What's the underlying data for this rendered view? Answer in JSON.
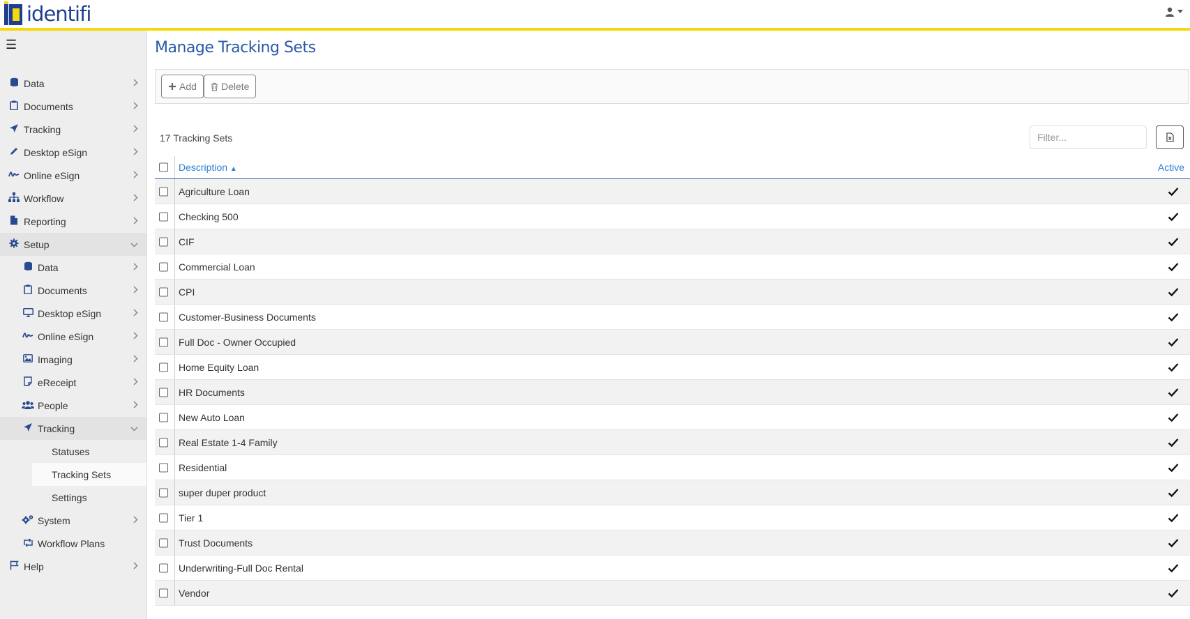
{
  "header": {
    "logo_text": "identifi",
    "user_icon": "user-icon"
  },
  "sidebar": {
    "items": [
      {
        "label": "Data",
        "icon": "database-icon"
      },
      {
        "label": "Documents",
        "icon": "clipboard-icon"
      },
      {
        "label": "Tracking",
        "icon": "paper-plane-icon"
      },
      {
        "label": "Desktop eSign",
        "icon": "pencil-icon"
      },
      {
        "label": "Online eSign",
        "icon": "signature-icon"
      },
      {
        "label": "Workflow",
        "icon": "sitemap-icon"
      },
      {
        "label": "Reporting",
        "icon": "file-icon"
      },
      {
        "label": "Setup",
        "icon": "gear-icon"
      }
    ],
    "setup_items": [
      {
        "label": "Data",
        "icon": "database-icon"
      },
      {
        "label": "Documents",
        "icon": "clipboard-icon"
      },
      {
        "label": "Desktop eSign",
        "icon": "monitor-icon"
      },
      {
        "label": "Online eSign",
        "icon": "signature-icon"
      },
      {
        "label": "Imaging",
        "icon": "image-icon"
      },
      {
        "label": "eReceipt",
        "icon": "receipt-icon"
      },
      {
        "label": "People",
        "icon": "users-icon"
      },
      {
        "label": "Tracking",
        "icon": "paper-plane-icon"
      }
    ],
    "tracking_items": [
      {
        "label": "Statuses"
      },
      {
        "label": "Tracking Sets"
      },
      {
        "label": "Settings"
      }
    ],
    "after_items": [
      {
        "label": "System",
        "icon": "gears-icon"
      },
      {
        "label": "Workflow Plans",
        "icon": "retweet-icon"
      }
    ],
    "help": {
      "label": "Help",
      "icon": "flag-icon"
    }
  },
  "main": {
    "title": "Manage Tracking Sets",
    "toolbar": {
      "add_label": "Add",
      "delete_label": "Delete"
    },
    "count_text": "17 Tracking Sets",
    "filter_placeholder": "Filter...",
    "table": {
      "columns": {
        "description": "Description",
        "active": "Active"
      },
      "rows": [
        {
          "description": "Agriculture Loan",
          "active": true
        },
        {
          "description": "Checking 500",
          "active": true
        },
        {
          "description": "CIF",
          "active": true
        },
        {
          "description": "Commercial Loan",
          "active": true
        },
        {
          "description": "CPI",
          "active": true
        },
        {
          "description": "Customer-Business Documents",
          "active": true
        },
        {
          "description": "Full Doc - Owner Occupied",
          "active": true
        },
        {
          "description": "Home Equity Loan",
          "active": true
        },
        {
          "description": "HR Documents",
          "active": true
        },
        {
          "description": "New Auto Loan",
          "active": true
        },
        {
          "description": "Real Estate 1-4 Family",
          "active": true
        },
        {
          "description": "Residential",
          "active": true
        },
        {
          "description": "super duper product",
          "active": true
        },
        {
          "description": "Tier 1",
          "active": true
        },
        {
          "description": "Trust Documents",
          "active": true
        },
        {
          "description": "Underwriting-Full Doc Rental",
          "active": true
        },
        {
          "description": "Vendor",
          "active": true
        }
      ]
    }
  }
}
